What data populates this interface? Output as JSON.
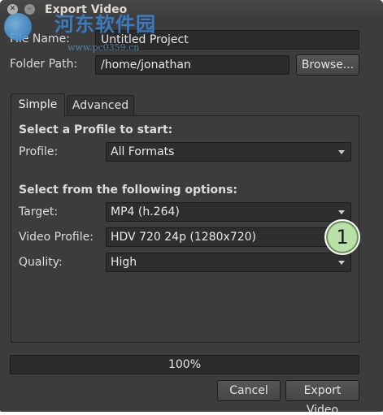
{
  "window": {
    "title": "Export Video"
  },
  "watermark": {
    "text": "河东软件园",
    "url": "www.pc0359.cn"
  },
  "form": {
    "file_name_label": "File Name:",
    "file_name_value": "Untitled Project",
    "folder_path_label": "Folder Path:",
    "folder_path_value": "/home/jonathan",
    "browse_label": "Browse..."
  },
  "tabs": [
    {
      "label": "Simple",
      "active": true
    },
    {
      "label": "Advanced",
      "active": false
    }
  ],
  "simple": {
    "profile_section": "Select a Profile to start:",
    "profile_label": "Profile:",
    "profile_value": "All Formats",
    "options_section": "Select from the following options:",
    "target_label": "Target:",
    "target_value": "MP4 (h.264)",
    "video_profile_label": "Video Profile:",
    "video_profile_value": "HDV 720 24p (1280x720)",
    "quality_label": "Quality:",
    "quality_value": "High"
  },
  "callout": {
    "number": "1"
  },
  "progress": {
    "percent": 100,
    "text": "100%"
  },
  "buttons": {
    "cancel_label": "Cancel",
    "export_label": "Export Video"
  },
  "icons": {
    "close": "close-icon",
    "minimize": "minimize-icon",
    "dropdown": "chevron-down-icon"
  }
}
